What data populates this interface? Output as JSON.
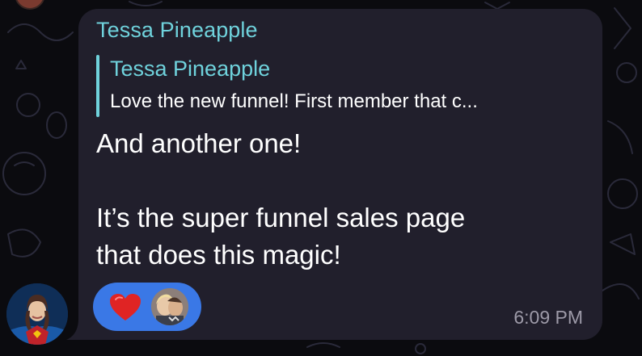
{
  "message": {
    "sender_name": "Tessa Pineapple",
    "reply_to": {
      "name": "Tessa Pineapple",
      "preview": "Love the new funnel! First member that c..."
    },
    "text_lines": [
      "And another one!",
      "",
      "It’s the super funnel sales page",
      "that does this magic!"
    ],
    "timestamp": "6:09 PM",
    "reactions": [
      {
        "emoji": "heart-icon",
        "color": "#e02424"
      }
    ]
  },
  "colors": {
    "background": "#0b0b0f",
    "bubble": "#211f2c",
    "accent_name": "#6fd2dc",
    "reaction_pill": "#3a78e6",
    "timestamp": "#9d9aa8"
  }
}
